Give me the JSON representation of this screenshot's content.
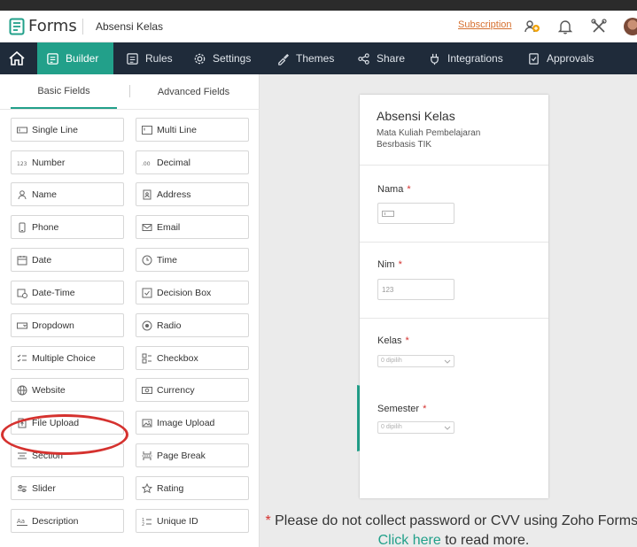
{
  "header": {
    "brand": "Forms",
    "form_name": "Absensi Kelas",
    "subscription": "Subscription"
  },
  "nav": {
    "builder": "Builder",
    "rules": "Rules",
    "settings": "Settings",
    "themes": "Themes",
    "share": "Share",
    "integrations": "Integrations",
    "approvals": "Approvals"
  },
  "sidebar": {
    "tab_basic": "Basic Fields",
    "tab_advanced": "Advanced Fields",
    "left": [
      "Single Line",
      "Number",
      "Name",
      "Phone",
      "Date",
      "Date-Time",
      "Dropdown",
      "Multiple Choice",
      "Website",
      "File Upload",
      "Section",
      "Slider",
      "Description"
    ],
    "right": [
      "Multi Line",
      "Decimal",
      "Address",
      "Email",
      "Time",
      "Decision Box",
      "Radio",
      "Checkbox",
      "Currency",
      "Image Upload",
      "Page Break",
      "Rating",
      "Unique ID"
    ]
  },
  "form": {
    "title": "Absensi Kelas",
    "description": "Mata Kuliah Pembelajaran Besrbasis TIK",
    "fields": {
      "nama": {
        "label": "Nama",
        "required": "*"
      },
      "nim": {
        "label": "Nim",
        "required": "*",
        "input_text": "123"
      },
      "kelas": {
        "label": "Kelas",
        "required": "*",
        "select_text": "0 dipilih"
      },
      "semester": {
        "label": "Semester",
        "required": "*",
        "select_text": "0 dipilih"
      }
    }
  },
  "notice": {
    "star": "*",
    "text_before": " Please do not collect password or CVV using Zoho Forms. ",
    "link": "Click here",
    "text_after": " to read more."
  },
  "colors": {
    "accent": "#22a08a",
    "nav_bg": "#1f2b3a",
    "required": "#d5322f",
    "subscription": "#d6702f",
    "annotation": "#d5322f"
  }
}
